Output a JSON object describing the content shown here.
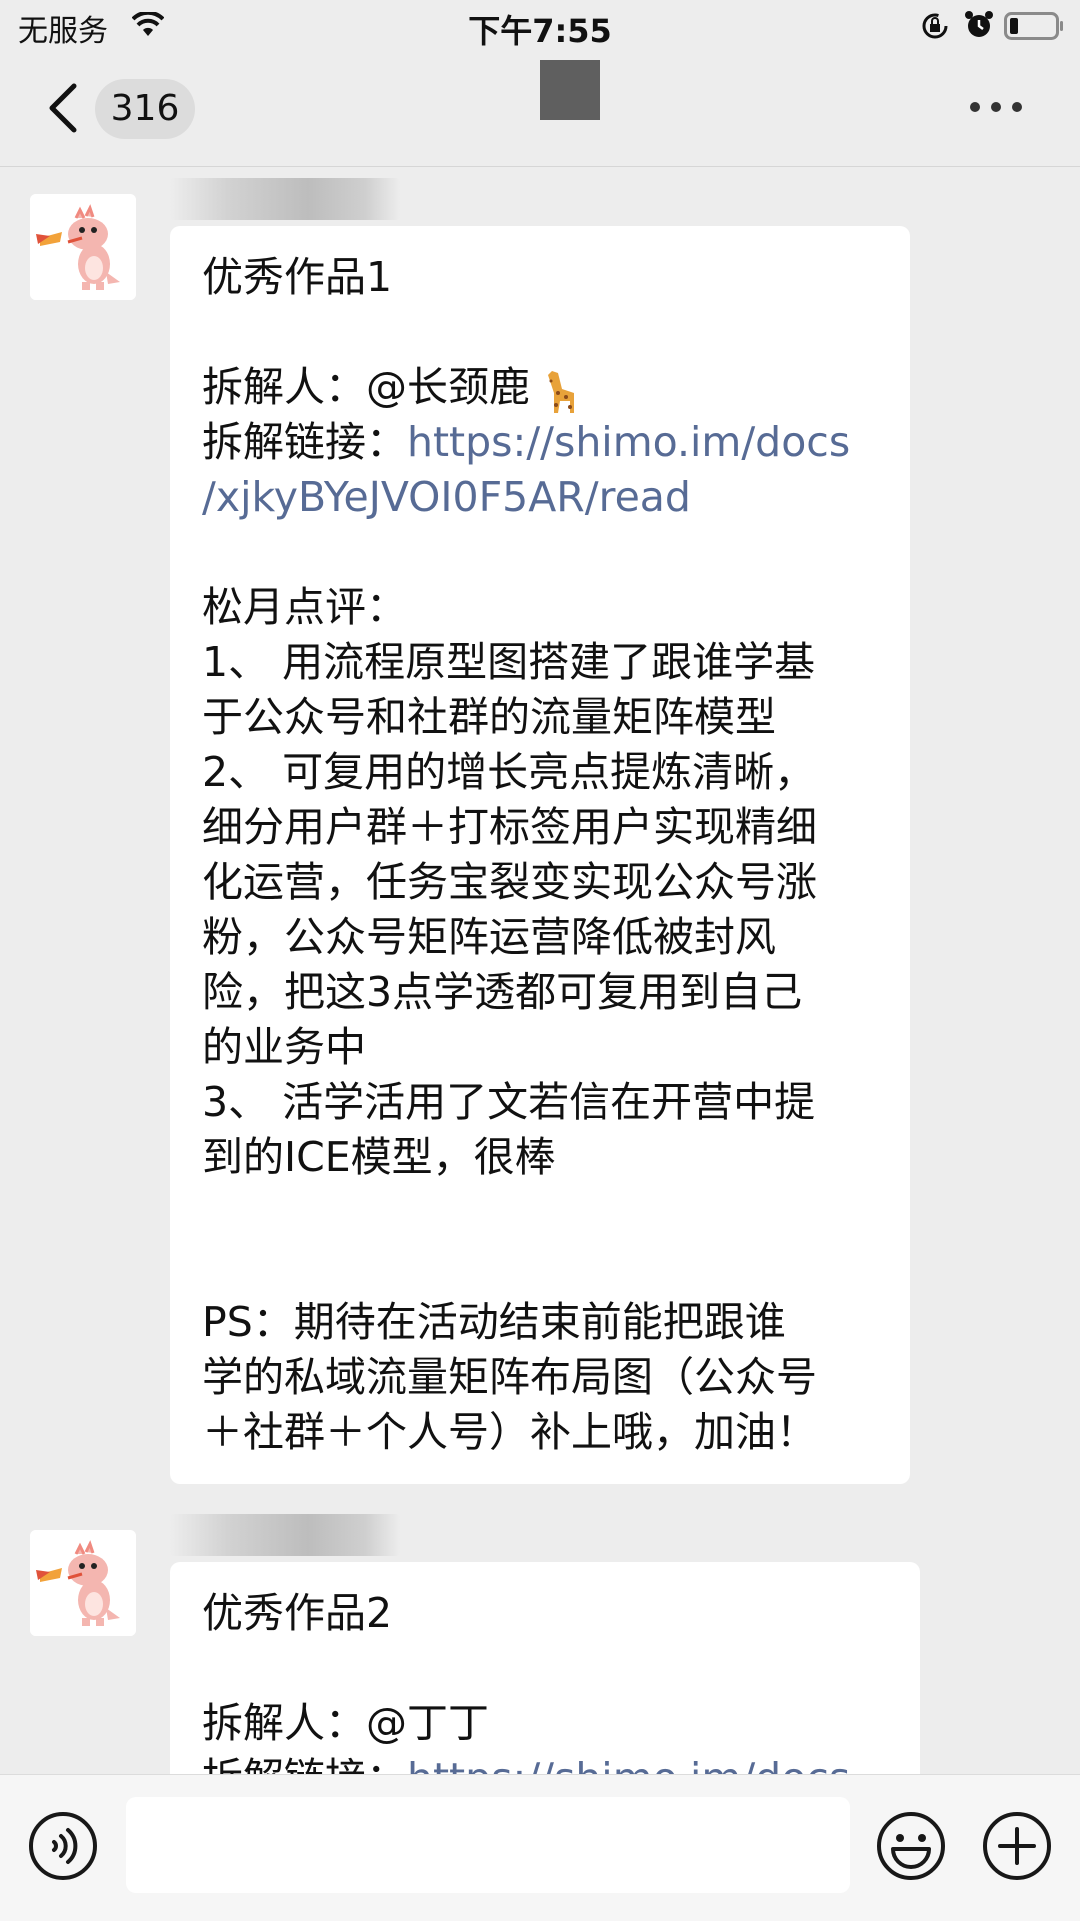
{
  "status_bar": {
    "carrier": "无服务",
    "time": "下午7:55"
  },
  "nav": {
    "unread_count": "316"
  },
  "messages": [
    {
      "title": "优秀作品1",
      "author_label": "拆解人：@长颈鹿",
      "link_label": "拆解链接：",
      "link_url_line1": "https://shimo.im/docs",
      "link_url_line2": "/xjkyBYeJVOI0F5AR/read",
      "review_title": "松月点评：",
      "review_lines": [
        "1、 用流程原型图搭建了跟谁学基",
        "于公众号和社群的流量矩阵模型",
        "2、 可复用的增长亮点提炼清晰，",
        "细分用户群＋打标签用户实现精细",
        "化运营，任务宝裂变实现公众号涨",
        "粉，公众号矩阵运营降低被封风",
        "险，把这3点学透都可复用到自己",
        "的业务中",
        "3、 活学活用了文若信在开营中提",
        "到的ICE模型，很棒"
      ],
      "ps_lines": [
        "PS：期待在活动结束前能把跟谁",
        "学的私域流量矩阵布局图（公众号",
        "＋社群＋个人号）补上哦，加油！"
      ]
    },
    {
      "title": "优秀作品2",
      "author_label": "拆解人：@丁丁",
      "link_label": "拆解链接：",
      "link_url_line1": "https://shimo.im/docs"
    }
  ],
  "icons": {
    "avatar": "dragon-avatar",
    "voice": "voice-icon",
    "emoji": "emoji-icon",
    "plus": "plus-icon",
    "giraffe": "giraffe-emoji"
  }
}
